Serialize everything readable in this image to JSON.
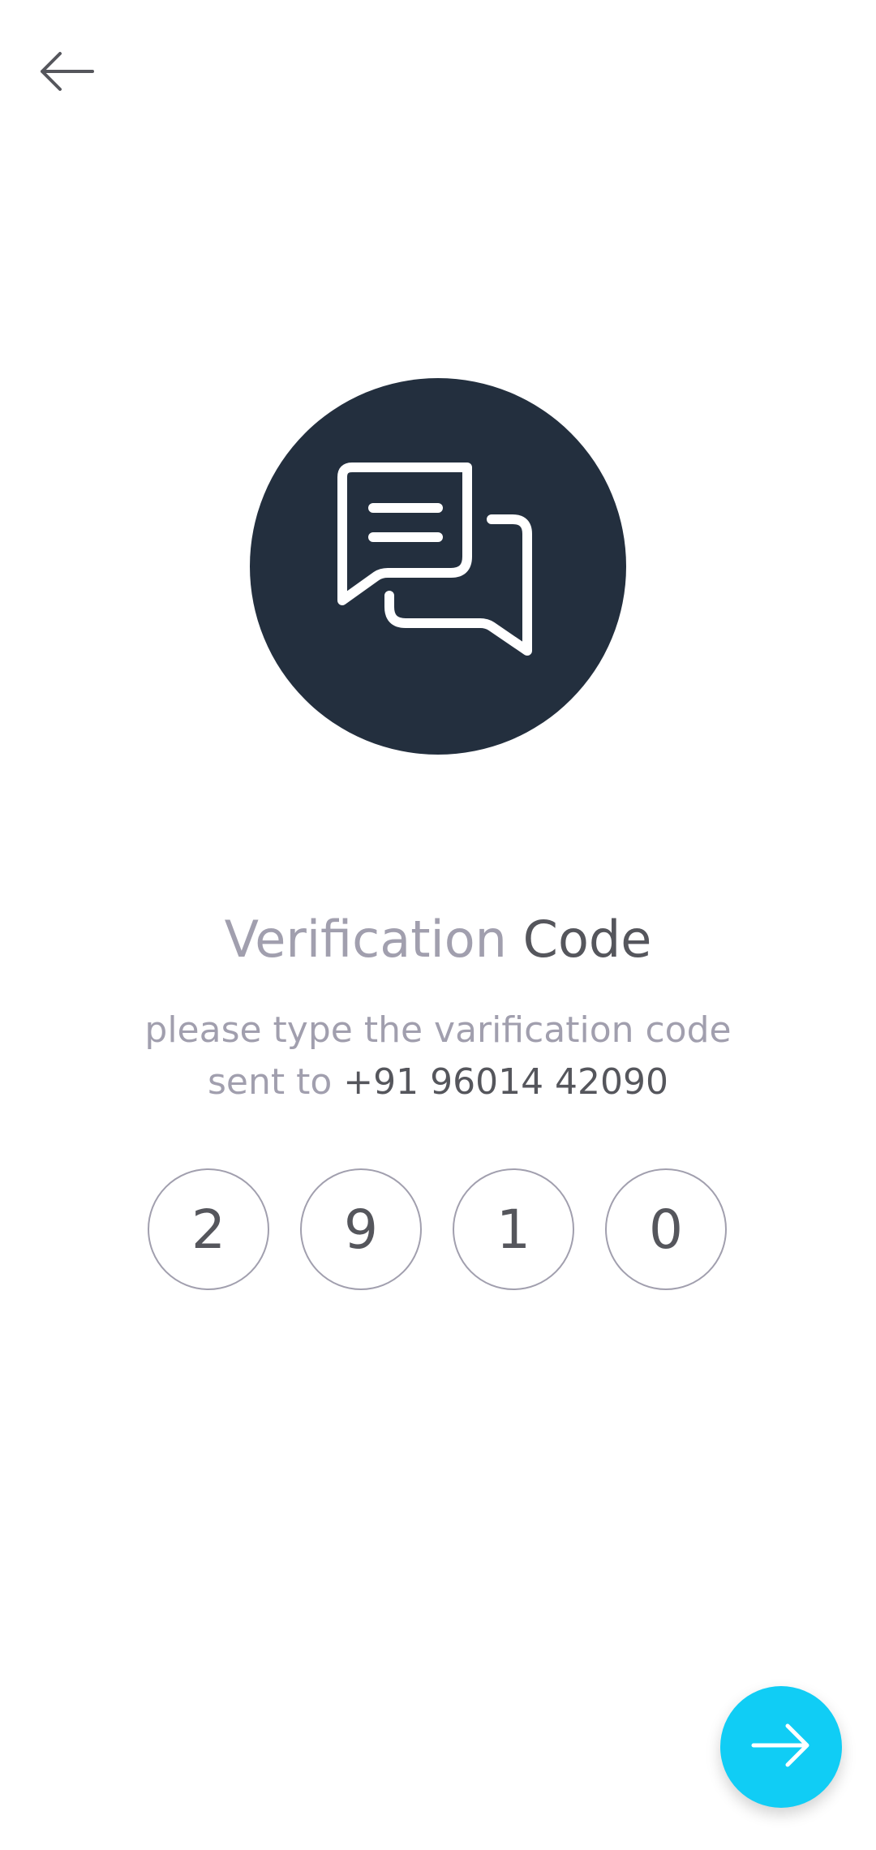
{
  "header": {
    "back_icon": "arrow-left-icon"
  },
  "hero": {
    "icon": "chat-bubbles-icon",
    "background_color": "#232f3e"
  },
  "title": {
    "part1": "Verification",
    "part2": "Code"
  },
  "subtitle": {
    "line1": "please type the varification code",
    "line2_prefix": "sent to",
    "phone": "+91 96014 42090"
  },
  "code": {
    "digits": [
      "2",
      "9",
      "1",
      "0"
    ]
  },
  "next_button": {
    "icon": "arrow-right-icon",
    "color": "#10cdf5"
  }
}
